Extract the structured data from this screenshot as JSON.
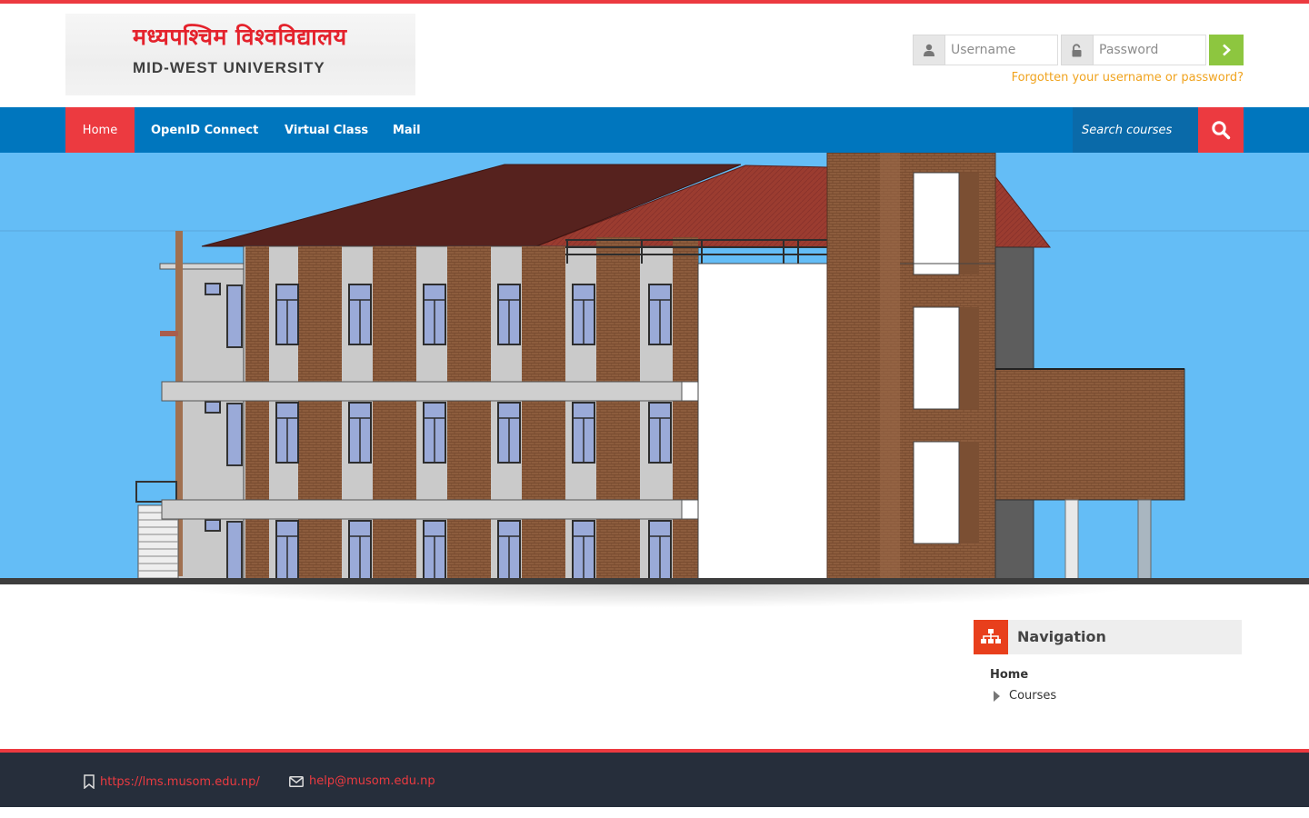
{
  "brand": {
    "name_nepali": "मध्यपश्चिम विश्वविद्यालय",
    "name_english": "MID-WEST UNIVERSITY"
  },
  "login": {
    "username_placeholder": "Username",
    "password_placeholder": "Password",
    "forgot_text": "Forgotten your username or password?"
  },
  "nav": {
    "items": [
      {
        "label": "Home",
        "active": true
      },
      {
        "label": "OpenID Connect"
      },
      {
        "label": "Virtual Class"
      },
      {
        "label": "Mail"
      }
    ],
    "search_placeholder": "Search courses"
  },
  "navigation_block": {
    "title": "Navigation",
    "home": "Home",
    "courses": "Courses"
  },
  "footer": {
    "website": "https://lms.musom.edu.np/",
    "email": "help@musom.edu.np"
  },
  "colors": {
    "accent_red": "#ec3a40",
    "nav_blue": "#0076be",
    "login_green": "#8dc63f",
    "forgot_orange": "#f0a31e",
    "footer_dark": "#262e3b",
    "sky": "#64bdf6",
    "brick": "#8a5a3c",
    "roof": "#56221e"
  },
  "icons": {
    "user": "user-icon",
    "lock": "unlock-icon",
    "submit": "chevron-right-icon",
    "search": "search-icon",
    "navigation": "sitemap-icon",
    "website": "bookmark-icon",
    "email": "envelope-icon"
  }
}
